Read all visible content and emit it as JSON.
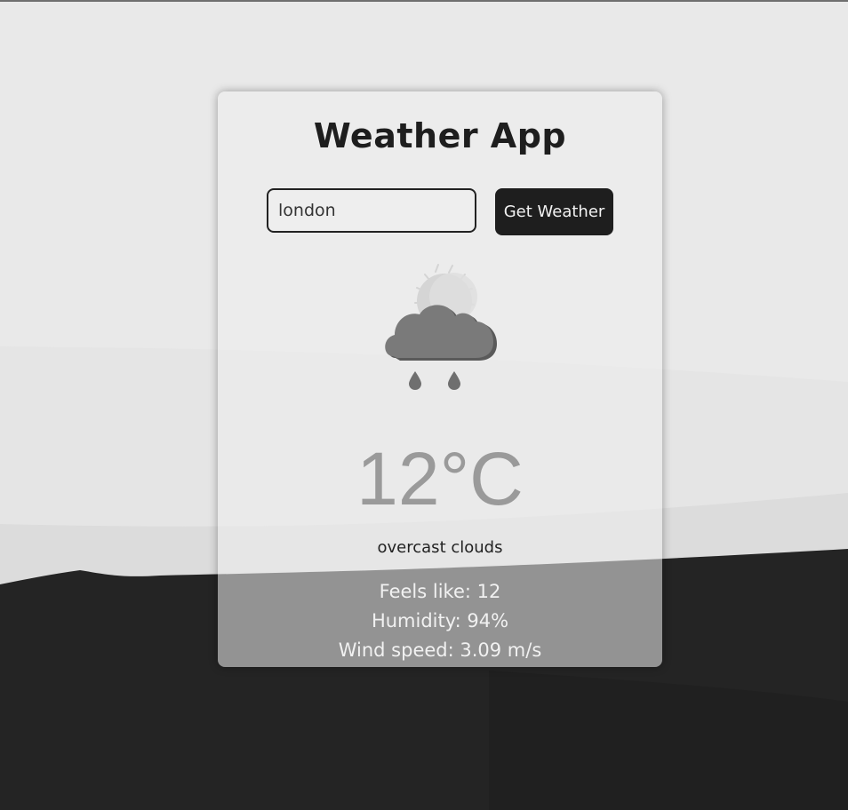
{
  "app": {
    "title": "Weather App"
  },
  "search": {
    "value": "london",
    "button_label": "Get Weather"
  },
  "weather": {
    "icon": "partly-sunny-rain-icon",
    "temperature": "12°C",
    "description": "overcast clouds",
    "feels_like": "Feels like: 12",
    "humidity": "Humidity: 94%",
    "wind_speed": "Wind speed: 3.09 m/s"
  },
  "colors": {
    "card_background": "#eeeeee",
    "button_background": "#1e1e1e",
    "dark_ground": "#242424",
    "temperature_text": "#9a9a9a"
  }
}
